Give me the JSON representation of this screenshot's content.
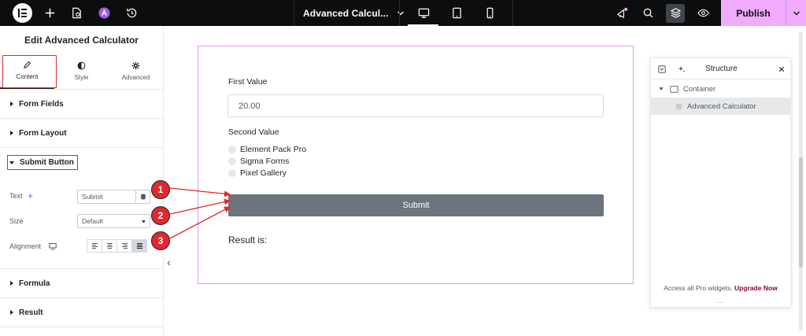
{
  "topbar": {
    "document_title": "Advanced Calcul...",
    "publish_label": "Publish"
  },
  "panel": {
    "title": "Edit Advanced Calculator",
    "tabs": [
      {
        "label": "Content"
      },
      {
        "label": "Style"
      },
      {
        "label": "Advanced"
      }
    ],
    "sections": {
      "form_fields": "Form Fields",
      "form_layout": "Form Layout",
      "submit_button": "Submit Button",
      "formula": "Formula",
      "result": "Result"
    },
    "controls": {
      "text_label": "Text",
      "text_value": "Submit",
      "size_label": "Size",
      "size_value": "Default",
      "alignment_label": "Alignment"
    }
  },
  "canvas": {
    "first_value_label": "First Value",
    "first_value": "20.00",
    "second_value_label": "Second Value",
    "options": [
      "Element Pack Pro",
      "Sigma Forms",
      "Pixel Gallery"
    ],
    "submit_label": "Submit",
    "result_label": "Result is:"
  },
  "markers": [
    "1",
    "2",
    "3"
  ],
  "structure": {
    "title": "Structure",
    "items": [
      "Container",
      "Advanced Calculator"
    ],
    "footer_text": "Access all Pro widgets.",
    "footer_link": "Upgrade Now",
    "grip": "..."
  },
  "colors": {
    "topbar_bg": "#0c0d0e",
    "publish_bg": "#f0abfc",
    "highlight_red": "#e0282e",
    "submit_btn": "#6c757d",
    "widget_outline": "#e39cf0",
    "upgrade_link": "#93003f"
  },
  "icons": [
    "elementor-logo-icon",
    "plus-icon",
    "page-settings-icon",
    "ai-icon",
    "history-icon",
    "chevron-down-icon",
    "desktop-icon",
    "tablet-icon",
    "mobile-icon",
    "notifications-icon",
    "search-icon",
    "layers-icon",
    "preview-eye-icon",
    "pencil-icon",
    "half-circle-icon",
    "gear-icon",
    "dynamic-tags-icon",
    "database-icon",
    "monitor-icon",
    "align-left-icon",
    "align-center-icon",
    "align-right-icon",
    "align-justify-icon",
    "close-icon",
    "sparkle-icon",
    "container-icon",
    "widget-icon"
  ]
}
